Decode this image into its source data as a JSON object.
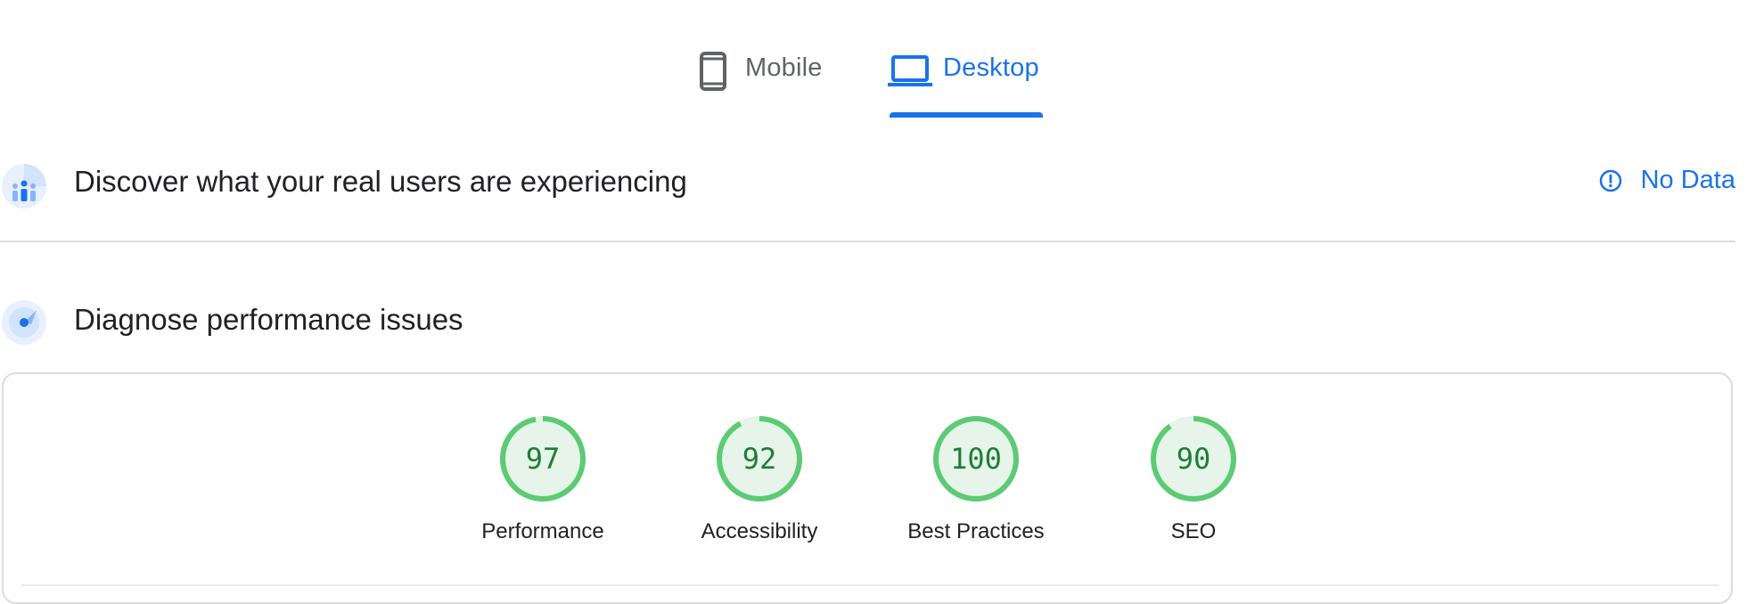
{
  "tabs": {
    "mobile_label": "Mobile",
    "desktop_label": "Desktop",
    "active": "Desktop"
  },
  "crux": {
    "title": "Discover what your real users are experiencing",
    "status_label": "No Data"
  },
  "diagnose": {
    "title": "Diagnose performance issues"
  },
  "scores": [
    {
      "label": "Performance",
      "value": "97",
      "score": 97
    },
    {
      "label": "Accessibility",
      "value": "92",
      "score": 92
    },
    {
      "label": "Best Practices",
      "value": "100",
      "score": 100
    },
    {
      "label": "SEO",
      "value": "90",
      "score": 90
    }
  ],
  "colors": {
    "accent": "#1a73e8",
    "pass_ring": "#0cce6b",
    "pass_fill": "#e6f4ea",
    "pass_text": "#1e7e34"
  }
}
